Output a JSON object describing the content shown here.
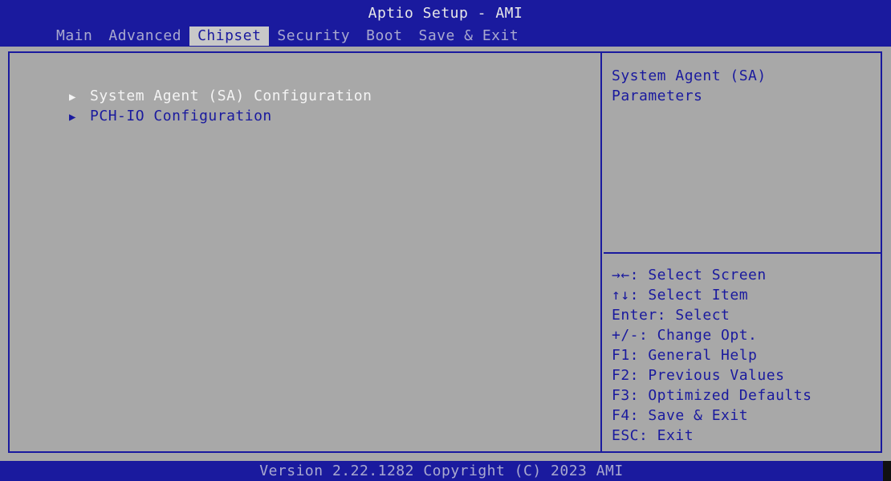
{
  "header": {
    "title": "Aptio Setup - AMI",
    "tabs": [
      {
        "label": "Main",
        "active": false
      },
      {
        "label": "Advanced",
        "active": false
      },
      {
        "label": "Chipset",
        "active": true
      },
      {
        "label": "Security",
        "active": false
      },
      {
        "label": "Boot",
        "active": false
      },
      {
        "label": "Save & Exit",
        "active": false
      }
    ]
  },
  "menu": {
    "items": [
      {
        "label": "System Agent (SA) Configuration",
        "selected": true
      },
      {
        "label": "PCH-IO Configuration",
        "selected": false
      }
    ]
  },
  "help": {
    "description_line1": "System Agent (SA)",
    "description_line2": "Parameters",
    "keys": [
      "→←: Select Screen",
      "↑↓: Select Item",
      "Enter: Select",
      "+/-: Change Opt.",
      "F1: General Help",
      "F2: Previous Values",
      "F3: Optimized Defaults",
      "F4: Save & Exit",
      "ESC: Exit"
    ]
  },
  "footer": {
    "text": "Version 2.22.1282 Copyright (C) 2023 AMI"
  },
  "colors": {
    "bios_blue": "#1a1a9e",
    "panel_gray": "#a8a8a8",
    "highlight_white": "#f4f4f4",
    "dim_tab_text": "#a9a9cf"
  }
}
